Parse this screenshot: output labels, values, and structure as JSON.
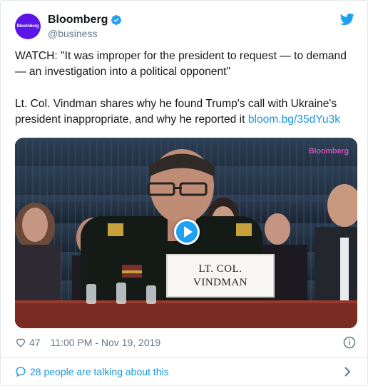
{
  "account": {
    "display_name": "Bloomberg",
    "handle": "@business",
    "avatar_text": "Bloomberg"
  },
  "icons": {
    "verified": "verified-badge-icon",
    "platform": "twitter-bird-icon",
    "like": "heart-icon",
    "info": "info-icon",
    "conversation": "speech-bubble-icon",
    "more": "chevron-right-icon",
    "play": "play-icon"
  },
  "tweet": {
    "paragraph1": "WATCH: \"It was improper for the president to request — to demand — an investigation into a political opponent\"",
    "paragraph2_text": "Lt. Col. Vindman shares why he found Trump's call with Ukraine's president inappropriate, and why he reported it ",
    "paragraph2_link": "bloom.bg/35dYu3k"
  },
  "media": {
    "watermark": "Bloomberg",
    "nameplate_line1": "LT. COL.",
    "nameplate_line2": "VINDMAN"
  },
  "meta": {
    "like_count": "47",
    "timestamp": "11:00 PM - Nov 19, 2019"
  },
  "footer": {
    "talking_text": "28 people are talking about this"
  },
  "colors": {
    "accent": "#1b95e0",
    "avatar_bg": "#5b15e6",
    "text_primary": "#14171a",
    "text_secondary": "#657786",
    "border": "#e1e8ed"
  }
}
